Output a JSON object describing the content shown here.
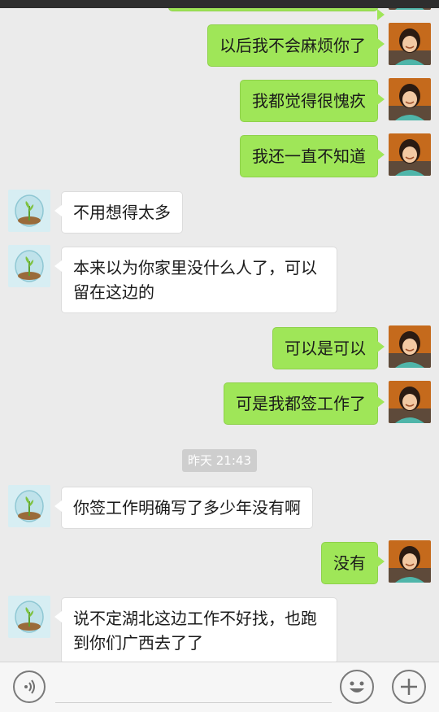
{
  "messages": [
    {
      "side": "me",
      "text": "以后我不会麻烦你了"
    },
    {
      "side": "me",
      "text": "我都觉得很愧疚"
    },
    {
      "side": "me",
      "text": "我还一直不知道"
    },
    {
      "side": "other",
      "text": "不用想得太多"
    },
    {
      "side": "other",
      "text": "本来以为你家里没什么人了，可以\n留在这边的"
    },
    {
      "side": "me",
      "text": "可以是可以"
    },
    {
      "side": "me",
      "text": "可是我都签工作了"
    },
    {
      "side": "other",
      "text": "你签工作明确写了多少年没有啊"
    },
    {
      "side": "me",
      "text": "没有"
    },
    {
      "side": "other",
      "text": "说不定湖北这边工作不好找，也跑\n到你们广西去了了"
    }
  ],
  "timestamp": "昨天 21:43",
  "input": {
    "value": "",
    "placeholder": ""
  },
  "icons": {
    "voice": "voice-icon",
    "emoji": "emoji-icon",
    "plus": "plus-icon"
  },
  "colors": {
    "my_bubble": "#9fe658",
    "other_bubble": "#ffffff",
    "background": "#ebebeb"
  }
}
